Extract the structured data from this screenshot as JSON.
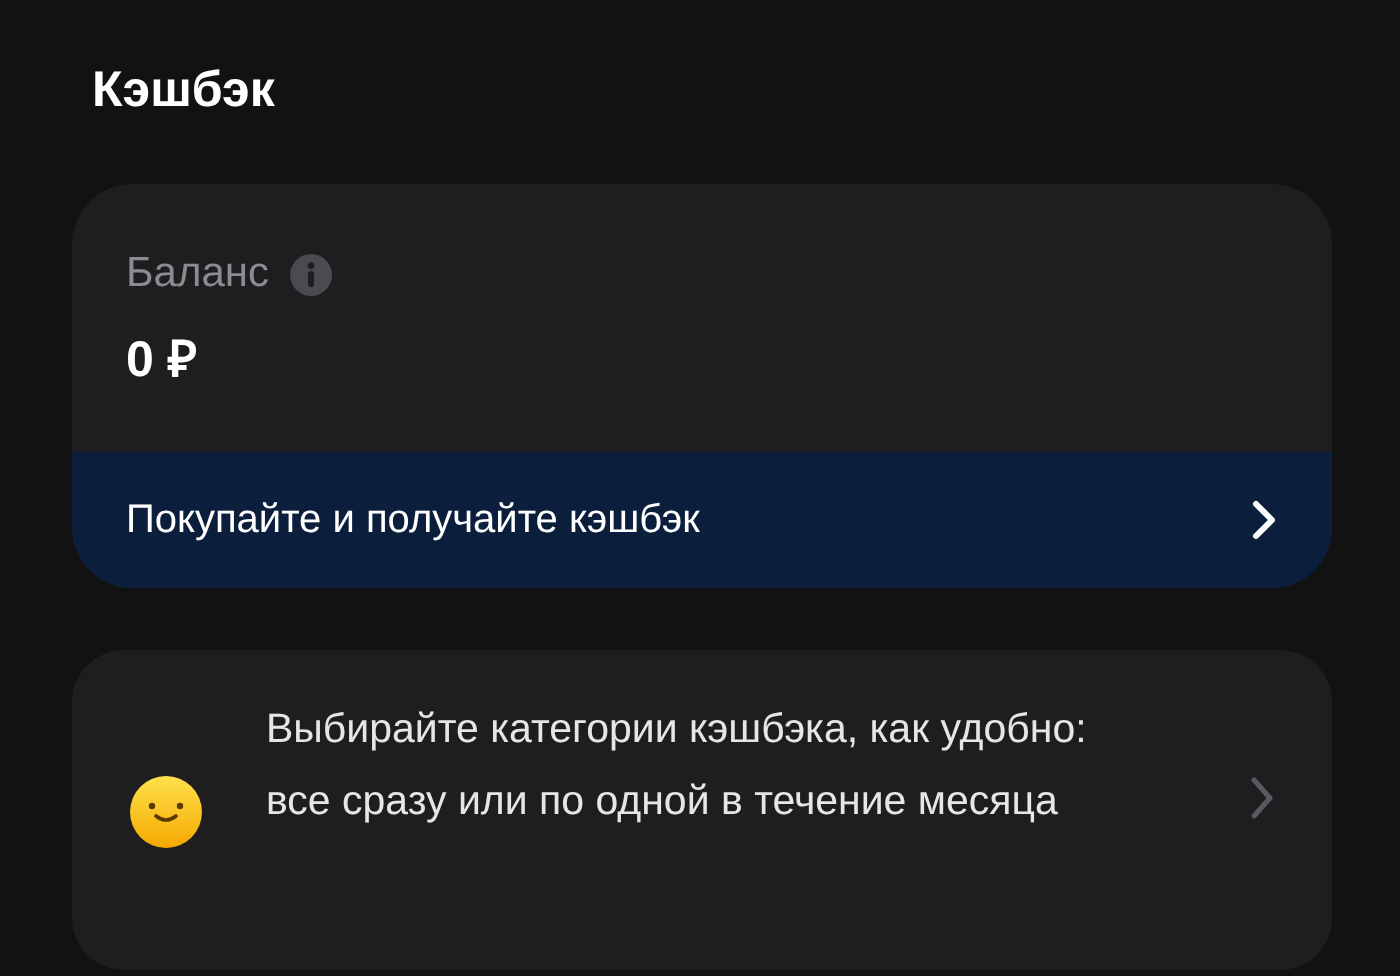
{
  "title": "Кэшбэк",
  "balance": {
    "label": "Баланс",
    "amount": "0 ₽"
  },
  "promo_link": {
    "label": "Покупайте и получайте кэшбэк"
  },
  "info_card": {
    "text": "Выбирайте категории кэшбэка, как удобно: все сразу или по одной в течение месяца"
  }
}
